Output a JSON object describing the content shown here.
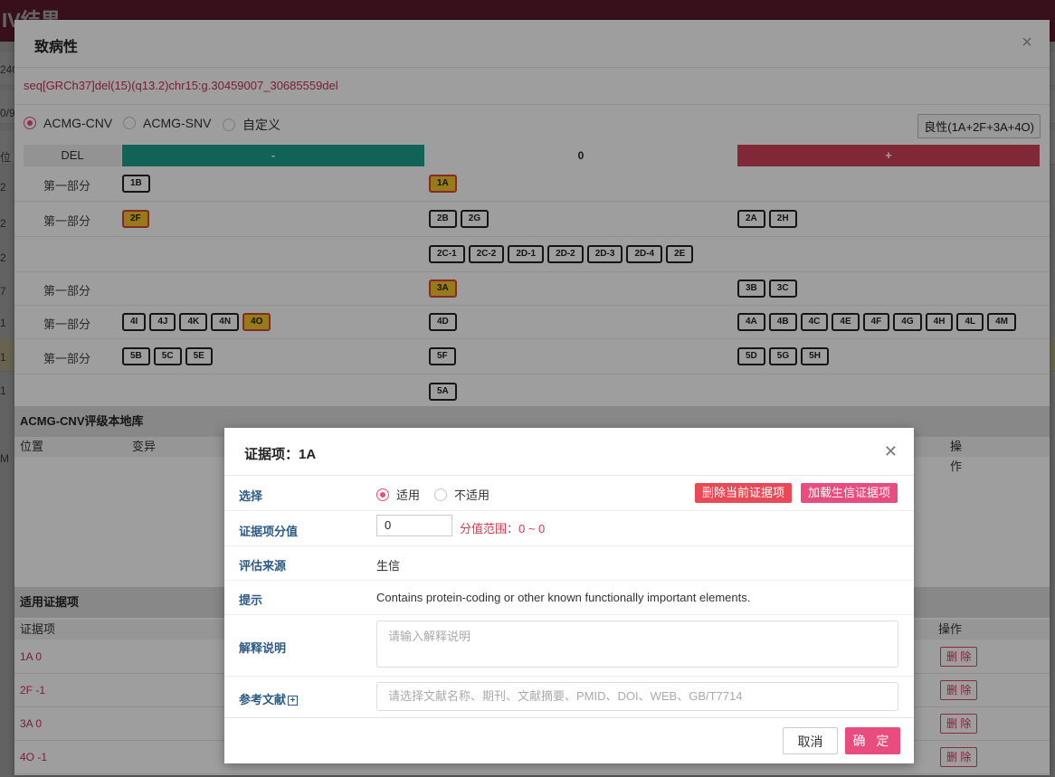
{
  "background": {
    "header_title": "IV结果",
    "strip_labels": [
      "240",
      "0/9",
      "位",
      "2",
      "2",
      "2",
      "7",
      "1",
      "1",
      "1",
      "M"
    ]
  },
  "pathogenicity_modal": {
    "title": "致病性",
    "sequence": "seq[GRCh37]del(15)(q13.2)chr15:g.30459007_30685559del",
    "radios": [
      {
        "label": "ACMG-CNV",
        "selected": true
      },
      {
        "label": "ACMG-SNV",
        "selected": false
      },
      {
        "label": "自定义",
        "selected": false
      }
    ],
    "classification_badge": "良性(1A+2F+3A+4O)",
    "grid_header": {
      "type": "DEL",
      "minus": "-",
      "zero": "0",
      "plus": "+"
    },
    "grid_rows": [
      {
        "label": "第一部分",
        "minus": [
          {
            "code": "1B",
            "sel": false
          }
        ],
        "zero": [
          {
            "code": "1A",
            "sel": true
          }
        ],
        "plus": []
      },
      {
        "label": "第一部分",
        "minus": [
          {
            "code": "2F",
            "sel": true
          }
        ],
        "zero": [
          {
            "code": "2B",
            "sel": false
          },
          {
            "code": "2G",
            "sel": false
          }
        ],
        "plus": [
          {
            "code": "2A",
            "sel": false
          },
          {
            "code": "2H",
            "sel": false
          }
        ]
      },
      {
        "label": "",
        "minus": [],
        "zero": [
          {
            "code": "2C-1",
            "sel": false
          },
          {
            "code": "2C-2",
            "sel": false
          },
          {
            "code": "2D-1",
            "sel": false
          },
          {
            "code": "2D-2",
            "sel": false
          },
          {
            "code": "2D-3",
            "sel": false
          },
          {
            "code": "2D-4",
            "sel": false
          },
          {
            "code": "2E",
            "sel": false
          }
        ],
        "plus": []
      },
      {
        "label": "第一部分",
        "minus": [],
        "zero": [
          {
            "code": "3A",
            "sel": true
          }
        ],
        "plus": [
          {
            "code": "3B",
            "sel": false
          },
          {
            "code": "3C",
            "sel": false
          }
        ]
      },
      {
        "label": "第一部分",
        "minus": [
          {
            "code": "4I",
            "sel": false
          },
          {
            "code": "4J",
            "sel": false
          },
          {
            "code": "4K",
            "sel": false
          },
          {
            "code": "4N",
            "sel": false
          },
          {
            "code": "4O",
            "sel": true
          }
        ],
        "zero": [
          {
            "code": "4D",
            "sel": false
          }
        ],
        "plus": [
          {
            "code": "4A",
            "sel": false
          },
          {
            "code": "4B",
            "sel": false
          },
          {
            "code": "4C",
            "sel": false
          },
          {
            "code": "4E",
            "sel": false
          },
          {
            "code": "4F",
            "sel": false
          },
          {
            "code": "4G",
            "sel": false
          },
          {
            "code": "4H",
            "sel": false
          },
          {
            "code": "4L",
            "sel": false
          },
          {
            "code": "4M",
            "sel": false
          }
        ]
      },
      {
        "label": "第一部分",
        "minus": [
          {
            "code": "5B",
            "sel": false
          },
          {
            "code": "5C",
            "sel": false
          },
          {
            "code": "5E",
            "sel": false
          }
        ],
        "zero": [
          {
            "code": "5F",
            "sel": false
          }
        ],
        "plus": [
          {
            "code": "5D",
            "sel": false
          },
          {
            "code": "5G",
            "sel": false
          },
          {
            "code": "5H",
            "sel": false
          }
        ]
      },
      {
        "label": "",
        "minus": [],
        "zero": [
          {
            "code": "5A",
            "sel": false
          }
        ],
        "plus": []
      }
    ],
    "local_db": {
      "title": "ACMG-CNV评级本地库",
      "columns": [
        "位置",
        "变异",
        "操作"
      ]
    },
    "applied_evidence": {
      "title": "适用证据项",
      "columns": [
        "证据项",
        "操作"
      ],
      "rows": [
        {
          "code": "1A  0",
          "action": "删 除"
        },
        {
          "code": "2F  -1",
          "action": "删 除"
        },
        {
          "code": "3A  0",
          "action": "删 除"
        },
        {
          "code": "4O  -1",
          "action": "删 除"
        }
      ]
    }
  },
  "evidence_modal": {
    "title": "证据项：1A",
    "select": {
      "label": "选择",
      "options": [
        {
          "label": "适用",
          "selected": true
        },
        {
          "label": "不适用",
          "selected": false
        }
      ],
      "delete_btn": "删除当前证据项",
      "load_btn": "加载生信证据项"
    },
    "score": {
      "label": "证据项分值",
      "value": "0",
      "range": "分值范围：0 ~ 0"
    },
    "source": {
      "label": "评估来源",
      "value": "生信"
    },
    "hint": {
      "label": "提示",
      "value": "Contains protein-coding or other known functionally important elements."
    },
    "explain": {
      "label": "解释说明",
      "placeholder": "请输入解释说明"
    },
    "refs": {
      "label": "参考文献",
      "placeholder": "请选择文献名称、期刊、文献摘要、PMID、DOI、WEB、GB/T7714"
    },
    "cancel": "取消",
    "ok": "确 定"
  },
  "colors": {
    "accent": "#e94c7e",
    "minus": "#1aa18c",
    "plus": "#cf4156",
    "chip_selected": "#f6c52a"
  }
}
